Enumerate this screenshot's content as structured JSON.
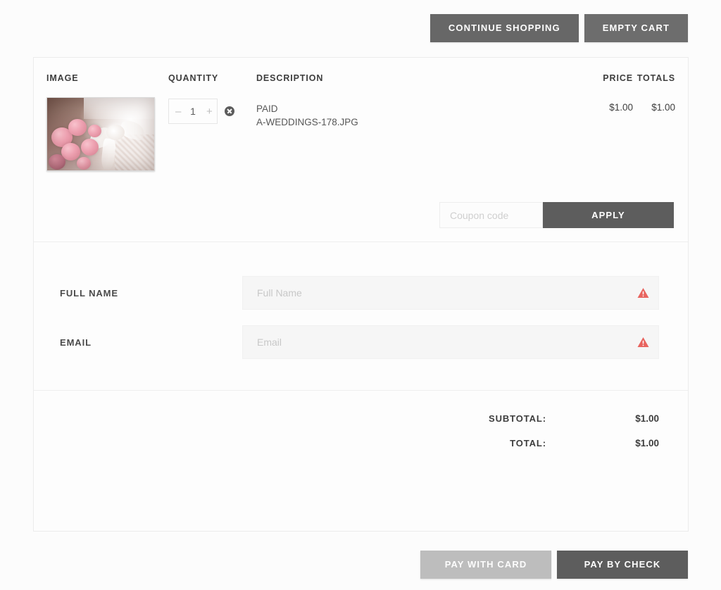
{
  "top_bar": {
    "continue_shopping": "CONTINUE SHOPPING",
    "empty_cart": "EMPTY CART"
  },
  "cart": {
    "headers": {
      "image": "IMAGE",
      "quantity": "QUANTITY",
      "description": "DESCRIPTION",
      "price": "PRICE",
      "totals": "TOTALS"
    },
    "item": {
      "thumbnail_alt": "wedding-bouquet-photo",
      "quantity": "1",
      "decrease_label": "–",
      "increase_label": "+",
      "remove_label": "remove item",
      "description_line1": "PAID",
      "description_line2": "A-WEDDINGS-178.JPG",
      "price": "$1.00",
      "total": "$1.00"
    }
  },
  "coupon": {
    "placeholder": "Coupon code",
    "value": "",
    "apply_label": "APPLY"
  },
  "form": {
    "full_name": {
      "label": "FULL NAME",
      "placeholder": "Full Name",
      "value": "",
      "error": true
    },
    "email": {
      "label": "EMAIL",
      "placeholder": "Email",
      "value": "",
      "error": true
    }
  },
  "totals": {
    "subtotal_label": "SUBTOTAL:",
    "subtotal_value": "$1.00",
    "total_label": "TOTAL:",
    "total_value": "$1.00"
  },
  "footer": {
    "pay_with_card": "PAY WITH CARD",
    "pay_by_check": "PAY BY CHECK"
  },
  "colors": {
    "button_dark": "#5d5d5d",
    "button_light": "#bdbdbd",
    "warning": "#e8645f",
    "card_border": "#ececec",
    "page_bg": "#fcfcfc"
  }
}
